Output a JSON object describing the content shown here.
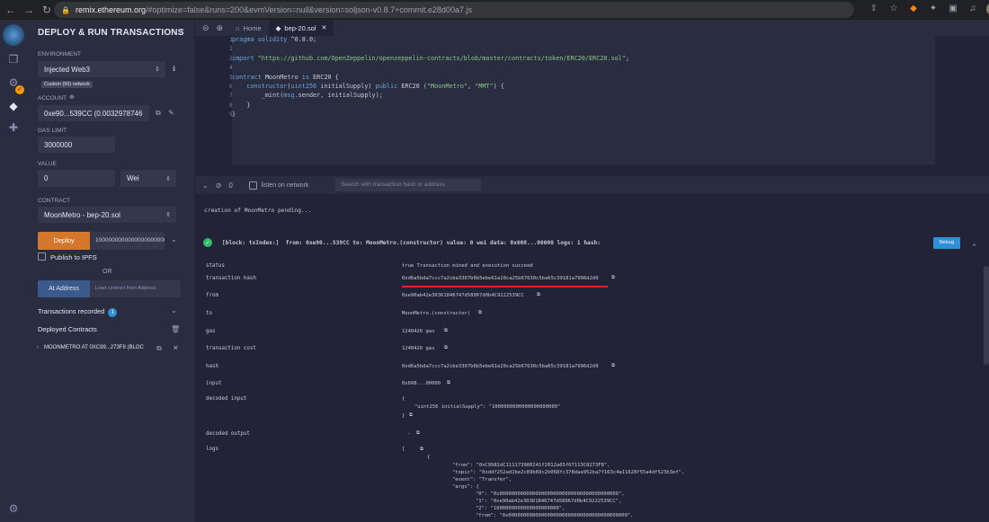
{
  "browser": {
    "url_host": "remix.ethereum.org",
    "url_path": "/#optimize=false&runs=200&evmVersion=null&version=soljson-v0.8.7+commit.e28d00a7.js"
  },
  "panel": {
    "title": "DEPLOY & RUN TRANSACTIONS",
    "environment_label": "ENVIRONMENT",
    "environment_value": "Injected Web3",
    "network_tag": "Custom (56) network",
    "account_label": "ACCOUNT",
    "account_value": "0xe90...539CC (0.0032978746",
    "gas_limit_label": "GAS LIMIT",
    "gas_limit_value": "3000000",
    "value_label": "VALUE",
    "value_amount": "0",
    "value_unit": "Wei",
    "contract_label": "CONTRACT",
    "contract_value": "MoonMetro - bep-20.sol",
    "deploy_label": "Deploy",
    "deploy_arg": "1000000000000000000000",
    "publish_ipfs": "Publish to IPFS",
    "or_text": "OR",
    "at_address_label": "At Address",
    "load_contract_placeholder": "Load contract from Address",
    "transactions_recorded": "Transactions recorded",
    "transactions_count": "1",
    "deployed_contracts": "Deployed Contracts",
    "deployed_item": "MOONMETRO AT 0XC99...273F8 (BLOC"
  },
  "tabs": {
    "home": "Home",
    "file": "bep-20.sol"
  },
  "editor": {
    "line_numbers": [
      "1",
      "2",
      "3",
      "4",
      "5",
      "6",
      "7",
      "8",
      "9"
    ]
  },
  "terminal": {
    "listen_label": "listen on network",
    "count": "0",
    "search_placeholder": "Search with transaction hash or address",
    "pending": "creation of MoonMetro pending...",
    "summary": "[block: txIndex:]  from: 0xe90...539CC to: MoonMetro.(constructor) value: 0 wei data: 0x608...00000 logs: 1 hash:",
    "debug_label": "Debug",
    "rows": [
      {
        "key": "status",
        "value": "true Transaction mined and execution succeed"
      },
      {
        "key": "transaction hash",
        "value": "0xd6a5bda7ccc7a2cbe3307b6b5ebe61e20ca25b67630c5ba65c39181a7096d2d9"
      },
      {
        "key": "from",
        "value": "0xe90ab42e30361846747d58967d0b4C9222539CC"
      },
      {
        "key": "to",
        "value": "MoonMetro.(constructor)"
      },
      {
        "key": "gas",
        "value": "1240426 gas"
      },
      {
        "key": "transaction cost",
        "value": "1240426 gas"
      },
      {
        "key": "hash",
        "value": "0xd6a5bda7ccc7a2cbe3307b6b5ebe61e20ca25b67630c5ba65c39181a7096d2d9"
      },
      {
        "key": "input",
        "value": "0x608...00000"
      },
      {
        "key": "decoded input",
        "value": "{"
      },
      {
        "key": "decoded output",
        "value": "-"
      },
      {
        "key": "logs",
        "value": "["
      }
    ],
    "decoded_input_body": "\"uint256 initialSupply\": \"1000000000000000000000\"",
    "decoded_input_close": "}",
    "logs_open": "{",
    "logs_lines": [
      "\"from\": \"0xC9982dC111173980241f2012a65f07113C8273F8\",",
      "\"topic\": \"0xddf252ad1be2c89b69c2b068fc378daa952ba7f163c4a11628f55a4df523b3ef\",",
      "\"event\": \"Transfer\",",
      "\"args\": {",
      "\"0\": \"0x0000000000000000000000000000000000000000\",",
      "\"1\": \"0xe90ab42e30361846747d58967d0b4C9222539CC\",",
      "\"2\": \"1000000000000000000000\",",
      "\"from\": \"0x0000000000000000000000000000000000000000\","
    ]
  }
}
